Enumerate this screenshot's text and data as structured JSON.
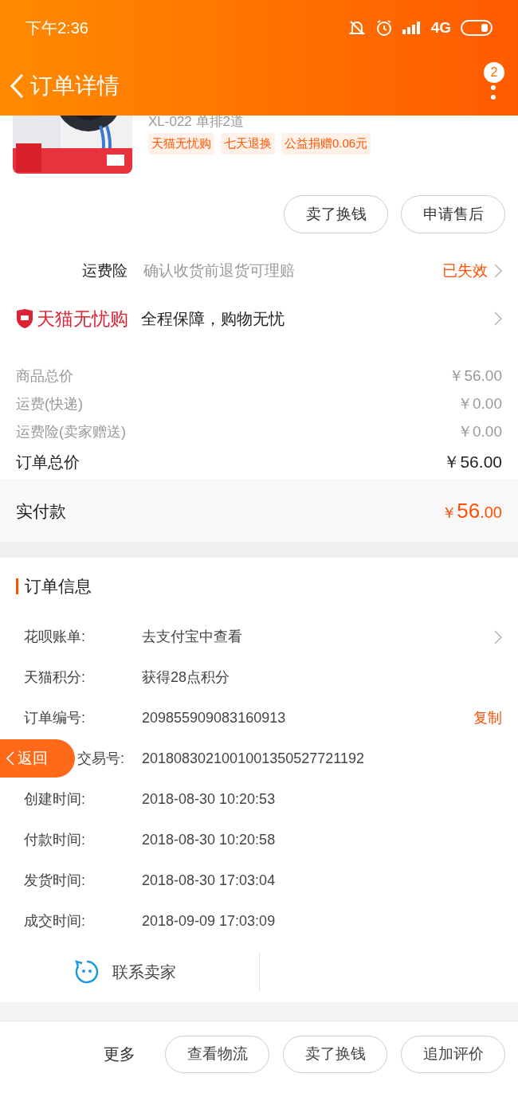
{
  "status_bar": {
    "time": "下午2:36",
    "network": "4G"
  },
  "header": {
    "title": "订单详情",
    "badge": "2"
  },
  "product": {
    "title": "XL-022 单排2道",
    "tags": [
      "天猫无忧购",
      "七天退换",
      "公益捐赠0.06元"
    ]
  },
  "item_actions": [
    "卖了换钱",
    "申请售后"
  ],
  "insurance": {
    "label": "运费险",
    "description": "确认收货前退货可理赔",
    "status": "已失效"
  },
  "guarantee": {
    "brand": "天猫无忧购",
    "slogan": "全程保障，购物无忧"
  },
  "prices": [
    {
      "label": "商品总价",
      "value": "￥56.00",
      "kind": "minor"
    },
    {
      "label": "运费(快递)",
      "value": "￥0.00",
      "kind": "minor"
    },
    {
      "label": "运费险(卖家赠送)",
      "value": "￥0.00",
      "kind": "minor"
    },
    {
      "label": "订单总价",
      "value": "￥56.00",
      "kind": "total"
    }
  ],
  "paid": {
    "label": "实付款",
    "currency": "￥",
    "integer": "56",
    "decimal": ".00"
  },
  "order_info": {
    "title": "订单信息",
    "rows": [
      {
        "label": "花呗账单:",
        "value": "去支付宝中查看",
        "kind": "link"
      },
      {
        "label": "天猫积分:",
        "value": "获得28点积分",
        "kind": "plain"
      },
      {
        "label": "订单编号:",
        "value": "209855909083160913",
        "kind": "copy",
        "action": "复制"
      },
      {
        "label": "交易号:",
        "value": "2018083021001001350527721192",
        "kind": "covered"
      },
      {
        "label": "创建时间:",
        "value": "2018-08-30 10:20:53",
        "kind": "plain"
      },
      {
        "label": "付款时间:",
        "value": "2018-08-30 10:20:58",
        "kind": "plain"
      },
      {
        "label": "发货时间:",
        "value": "2018-08-30 17:03:04",
        "kind": "plain"
      },
      {
        "label": "成交时间:",
        "value": "2018-09-09 17:03:09",
        "kind": "plain"
      }
    ]
  },
  "contact": "联系卖家",
  "float_back": "返回",
  "bottom_bar": {
    "more": "更多",
    "buttons": [
      "查看物流",
      "卖了换钱",
      "追加评价"
    ]
  }
}
